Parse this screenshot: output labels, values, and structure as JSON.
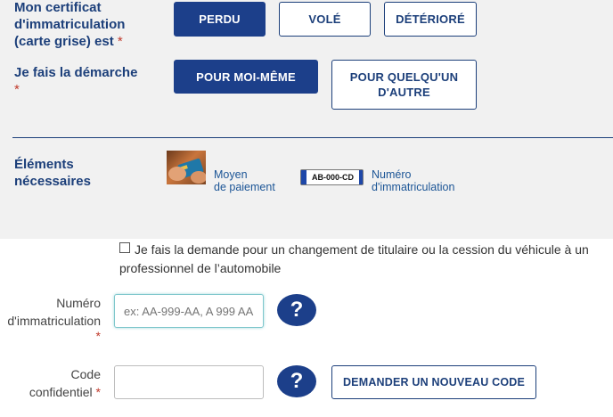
{
  "section1": {
    "certificate_label": "Mon certificat d'immatriculation (carte grise) est",
    "required_mark": "*",
    "options": {
      "lost": "PERDU",
      "stolen": "VOLÉ",
      "damaged": "DÉTÉRIORÉ"
    },
    "approach_label": "Je fais la démarche",
    "approach_options": {
      "self": "POUR MOI-MÊME",
      "other": "POUR QUELQU'UN D'AUTRE"
    }
  },
  "elements": {
    "label": "Éléments nécessaires",
    "payment_line1": "Moyen",
    "payment_line2": "de paiement",
    "plate_text": "AB-000-CD",
    "registration_line1": "Numéro",
    "registration_line2": "d'immatriculation"
  },
  "form": {
    "checkbox_label": "Je fais la demande pour un changement de titulaire ou la cession du véhicule à un professionnel de l’automobile",
    "registration_label_line1": "Numéro",
    "registration_label_line2": "d'immatriculation",
    "registration_placeholder": "ex: AA-999-AA, A 999 AA",
    "code_label_line1": "Code",
    "code_label_line2": "confidentiel",
    "help_symbol": "?",
    "new_code_button": "DEMANDER UN NOUVEAU CODE"
  },
  "colors": {
    "primary": "#1c3f8a",
    "panel_bg": "#f1f1f1",
    "required": "#c0392b",
    "link": "#1c5596"
  },
  "icons": {
    "payment": "credit-card-photo-icon",
    "plate": "license-plate-icon",
    "help": "question-mark-icon"
  }
}
